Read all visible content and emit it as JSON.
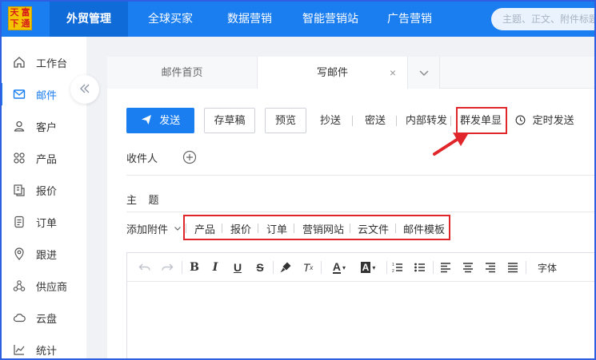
{
  "logo": {
    "chars": [
      "天",
      "富",
      "下",
      "通"
    ]
  },
  "topnav": {
    "items": [
      "外贸管理",
      "全球买家",
      "数据营销",
      "智能营销站",
      "广告营销"
    ],
    "active_index": 0,
    "search_placeholder": "主题、正文、附件标题"
  },
  "sidebar": {
    "items": [
      {
        "label": "工作台",
        "icon": "home-icon"
      },
      {
        "label": "邮件",
        "icon": "mail-icon"
      },
      {
        "label": "客户",
        "icon": "user-icon"
      },
      {
        "label": "产品",
        "icon": "grid-icon"
      },
      {
        "label": "报价",
        "icon": "quote-icon"
      },
      {
        "label": "订单",
        "icon": "order-icon"
      },
      {
        "label": "跟进",
        "icon": "location-icon"
      },
      {
        "label": "供应商",
        "icon": "supplier-icon"
      },
      {
        "label": "云盘",
        "icon": "cloud-icon"
      },
      {
        "label": "统计",
        "icon": "chart-icon"
      }
    ],
    "active_index": 1
  },
  "tabs": {
    "items": [
      "邮件首页",
      "写邮件"
    ],
    "active_index": 1,
    "close": "×"
  },
  "toolbar": {
    "send": "发送",
    "save_draft": "存草稿",
    "preview": "预览",
    "cc": "抄送",
    "bcc": "密送",
    "internal_forward": "内部转发",
    "bulk_single": "群发单显",
    "scheduled_send": "定时发送"
  },
  "fields": {
    "recipient": "收件人",
    "subject": "主    题"
  },
  "attachments": {
    "label": "添加附件",
    "items": [
      "产品",
      "报价",
      "订单",
      "营销网站",
      "云文件",
      "邮件模板"
    ]
  },
  "editor": {
    "font_label": "字体"
  },
  "colors": {
    "accent": "#1a7ef0",
    "highlight": "#e0262a"
  }
}
